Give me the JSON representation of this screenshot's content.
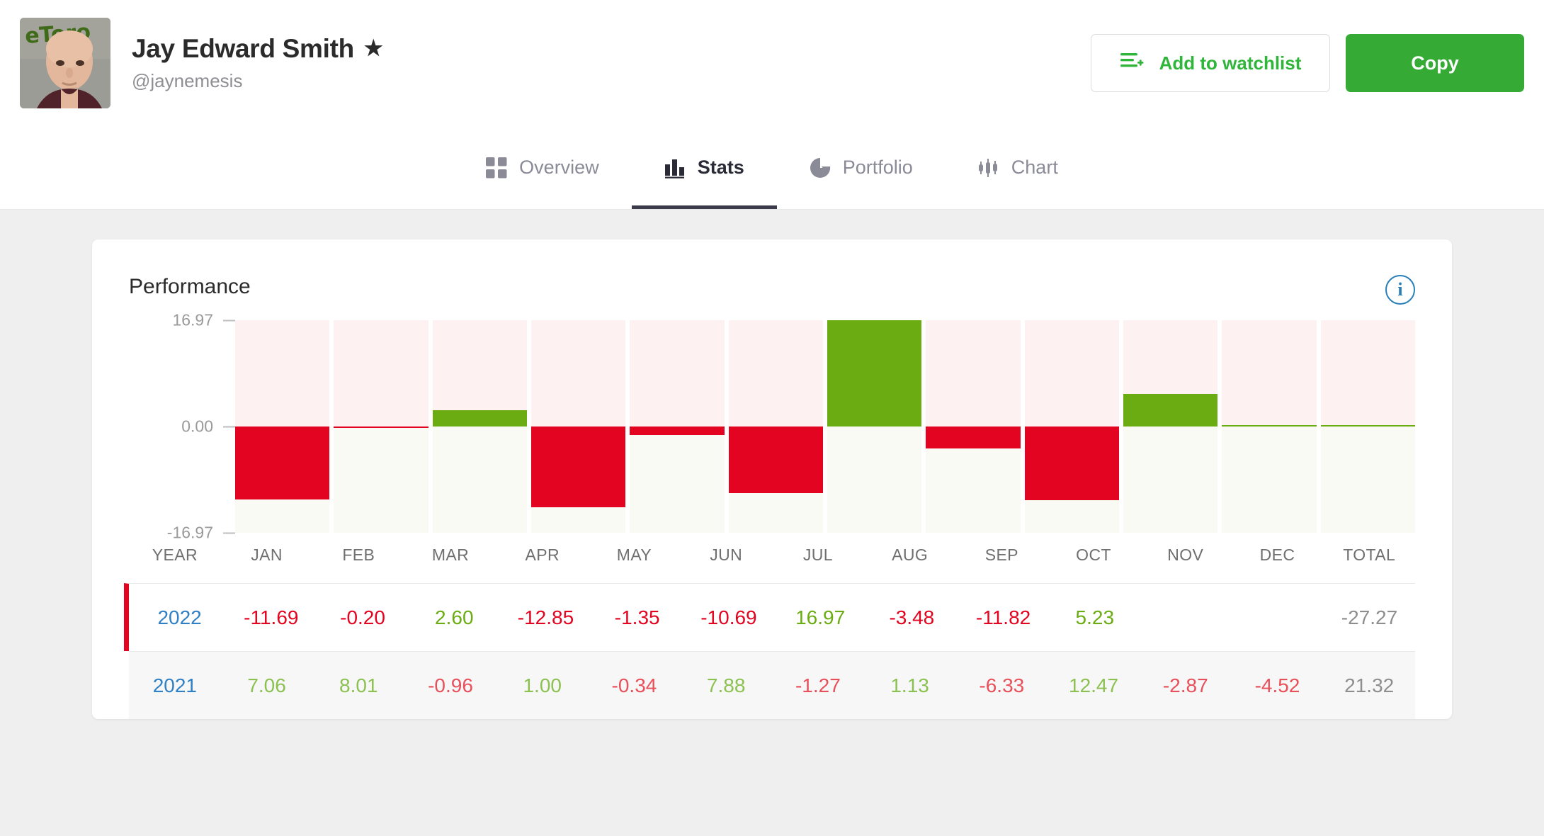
{
  "header": {
    "display_name": "Jay Edward Smith",
    "star_icon": "star-icon",
    "username": "@jaynemesis",
    "avatar_watermark": "eToro",
    "watchlist_label": "Add to watchlist",
    "watchlist_icon": "list-plus-icon",
    "copy_label": "Copy",
    "accent_green": "#35aa35",
    "link_green": "#2fb53a"
  },
  "tabs": [
    {
      "label": "Overview",
      "icon": "grid-icon",
      "active": false
    },
    {
      "label": "Stats",
      "icon": "bar-chart-icon",
      "active": true
    },
    {
      "label": "Portfolio",
      "icon": "pie-chart-icon",
      "active": false
    },
    {
      "label": "Chart",
      "icon": "candlestick-icon",
      "active": false
    }
  ],
  "card": {
    "title": "Performance",
    "info_icon": "info-icon",
    "info_glyph": "i"
  },
  "chart_data": {
    "type": "bar",
    "title": "Performance",
    "xlabel": "",
    "ylabel": "",
    "categories": [
      "JAN",
      "FEB",
      "MAR",
      "APR",
      "MAY",
      "JUN",
      "JUL",
      "AUG",
      "SEP",
      "OCT",
      "NOV",
      "DEC"
    ],
    "values": [
      -11.69,
      -0.2,
      2.6,
      -12.85,
      -1.35,
      -10.69,
      16.97,
      -3.48,
      -11.82,
      5.23,
      null,
      null
    ],
    "ylim": [
      -16.97,
      16.97
    ],
    "yticks": [
      "16.97",
      "0.00",
      "-16.97"
    ],
    "ytick_values": [
      16.97,
      0.0,
      -16.97
    ],
    "grid": false,
    "legend": "none",
    "colors": {
      "positive": "#6aac12",
      "negative": "#e30421",
      "band_positive": "#fdf1f1",
      "band_negative": "#f9faf4"
    }
  },
  "table": {
    "columns": [
      "YEAR",
      "JAN",
      "FEB",
      "MAR",
      "APR",
      "MAY",
      "JUN",
      "JUL",
      "AUG",
      "SEP",
      "OCT",
      "NOV",
      "DEC",
      "TOTAL"
    ],
    "rows": [
      {
        "year": "2022",
        "selected": true,
        "values": [
          "-11.69",
          "-0.20",
          "2.60",
          "-12.85",
          "-1.35",
          "-10.69",
          "16.97",
          "-3.48",
          "-11.82",
          "5.23",
          "",
          ""
        ],
        "total": "-27.27"
      },
      {
        "year": "2021",
        "selected": false,
        "values": [
          "7.06",
          "8.01",
          "-0.96",
          "1.00",
          "-0.34",
          "7.88",
          "-1.27",
          "1.13",
          "-6.33",
          "12.47",
          "-2.87",
          "-4.52"
        ],
        "total": "21.32"
      }
    ]
  }
}
